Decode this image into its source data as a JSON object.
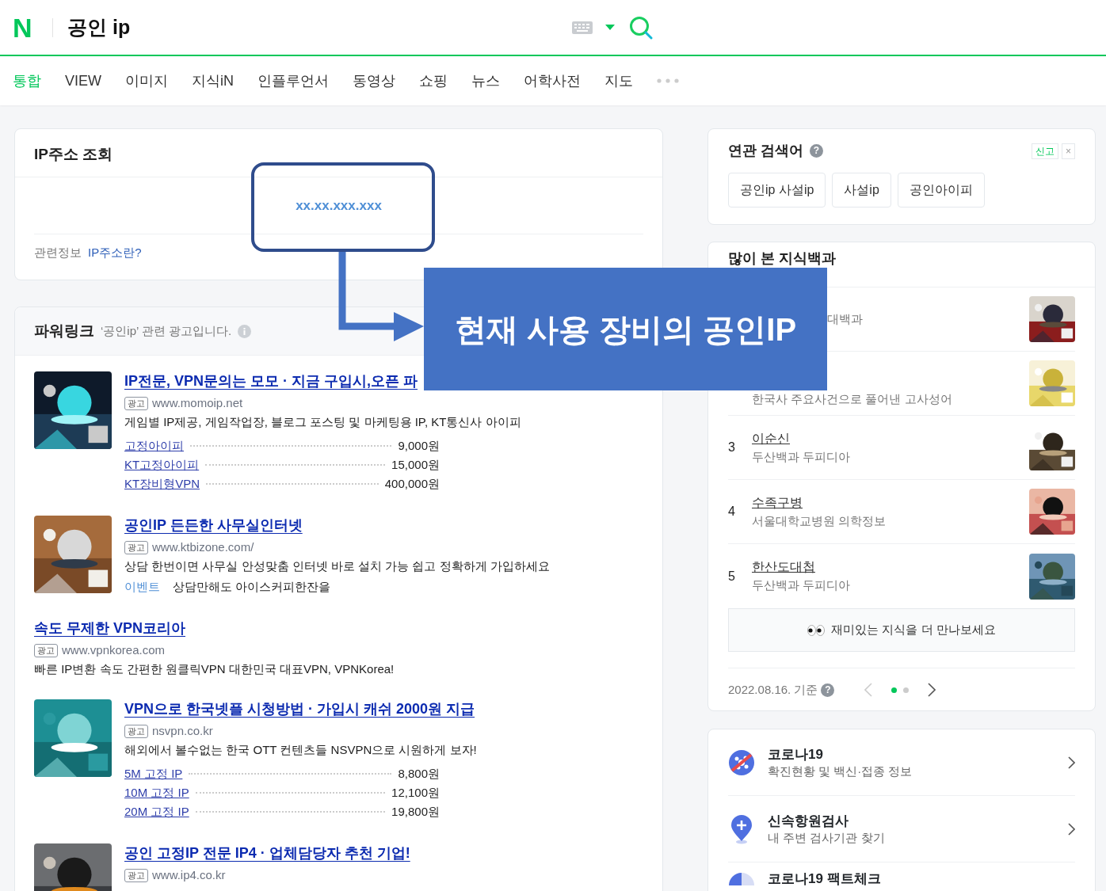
{
  "header": {
    "logo": "N",
    "query": "공인 ip"
  },
  "tabs": [
    {
      "label": "통합",
      "selected": true
    },
    {
      "label": "VIEW",
      "selected": false
    },
    {
      "label": "이미지",
      "selected": false
    },
    {
      "label": "지식iN",
      "selected": false
    },
    {
      "label": "인플루언서",
      "selected": false
    },
    {
      "label": "동영상",
      "selected": false
    },
    {
      "label": "쇼핑",
      "selected": false
    },
    {
      "label": "뉴스",
      "selected": false
    },
    {
      "label": "어학사전",
      "selected": false
    },
    {
      "label": "지도",
      "selected": false
    }
  ],
  "ip_card": {
    "title": "IP주소 조회",
    "ip": "xx.xx.xxx.xxx",
    "related_label": "관련정보",
    "related_link": "IP주소란?"
  },
  "annotation": {
    "text": "현재 사용 장비의 공인IP"
  },
  "powerlink": {
    "title": "파워링크",
    "subtitle": "‘공인ip’ 관련 광고입니다.",
    "ads": [
      {
        "kind": "thumb",
        "title": "IP전문, VPN문의는 모모 · 지금 구입시,오픈 파",
        "badge": "광고",
        "url": "www.momoip.net",
        "desc": "게임별 IP제공, 게임작업장, 블로그 포스팅 및 마케팅용 IP, KT통신사 아이피",
        "prices": [
          {
            "label": "고정아이피",
            "price": "9,000원"
          },
          {
            "label": "KT고정아이피",
            "price": "15,000원"
          },
          {
            "label": "KT장비형VPN",
            "price": "400,000원"
          }
        ]
      },
      {
        "kind": "thumb",
        "title": "공인IP 든든한 사무실인터넷",
        "badge": "광고",
        "url": "www.ktbizone.com/",
        "desc": "상담 한번이면 사무실 안성맞춤 인터넷 바로 설치 가능 쉽고 정확하게 가입하세요",
        "event": {
          "label": "이벤트",
          "text": "상담만해도 아이스커피한잔을"
        }
      },
      {
        "kind": "text",
        "title": "속도 무제한 VPN코리아",
        "badge": "광고",
        "url": "www.vpnkorea.com",
        "desc": "빠른 IP변환 속도 간편한 원클릭VPN 대한민국 대표VPN, VPNKorea!"
      },
      {
        "kind": "thumb",
        "title": "VPN으로 한국넷플 시청방법 · 가입시 캐쉬 2000원 지급",
        "badge": "광고",
        "url": "nsvpn.co.kr",
        "desc": "해외에서 볼수없는 한국 OTT 컨텐츠들 NSVPN으로 시원하게 보자!",
        "prices": [
          {
            "label": "5M 고정 IP",
            "price": "8,800원"
          },
          {
            "label": "10M 고정 IP",
            "price": "12,100원"
          },
          {
            "label": "20M 고정 IP",
            "price": "19,800원"
          }
        ]
      },
      {
        "kind": "thumb",
        "title": "공인 고정IP 전문 IP4 · 업체담당자 추천 기업!",
        "badge": "광고",
        "url": "www.ip4.co.kr"
      }
    ]
  },
  "related": {
    "title": "연관 검색어",
    "help": "?",
    "report": "신고",
    "close": "×",
    "tags": [
      "공인ip 사설ip",
      "사설ip",
      "공인아이피"
    ]
  },
  "encyclopedia": {
    "title": "많이 본 지식백과",
    "items": [
      {
        "source": "대백과"
      },
      {
        "source": "한국사 주요사건으로 풀어낸 고사성어"
      },
      {
        "rank": "3",
        "title": "이순신",
        "source": "두산백과 두피디아"
      },
      {
        "rank": "4",
        "title": "수족구병",
        "source": "서울대학교병원 의학정보"
      },
      {
        "rank": "5",
        "title": "한산도대첩",
        "source": "두산백과 두피디아"
      }
    ],
    "more": "재미있는 지식을 더 만나보세요",
    "date": "2022.08.16. 기준",
    "help": "?",
    "pages": [
      {
        "selected": true
      },
      {
        "selected": false
      }
    ]
  },
  "services": [
    {
      "kind": "virus",
      "title": "코로나19",
      "sub": "확진현황 및 백신·접종 정보"
    },
    {
      "kind": "pin",
      "title": "신속항원검사",
      "sub": "내 주변 검사기관 찾기"
    },
    {
      "kind": "chart",
      "title": "코로나19 팩트체크"
    }
  ]
}
